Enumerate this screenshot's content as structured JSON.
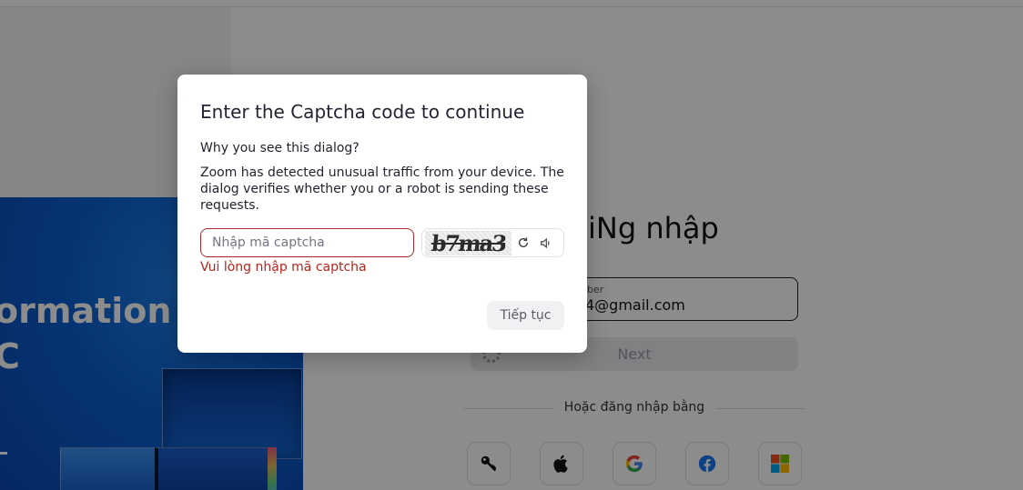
{
  "hero": {
    "text": "ormation\nC"
  },
  "login": {
    "title": "iNg nhập",
    "email_label": "ber",
    "email_value": "4@gmail.com",
    "next_label": "Next",
    "or_label": "Hoặc đăng nhập bằng",
    "social": [
      "key-icon",
      "apple-icon",
      "google-icon",
      "facebook-icon",
      "microsoft-icon"
    ]
  },
  "dialog": {
    "title": "Enter the Captcha code to continue",
    "question": "Why you see this dialog?",
    "description": "Zoom has detected unusual traffic from your device. The dialog verifies whether you or a robot is sending these requests.",
    "input_placeholder": "Nhập mã captcha",
    "input_value": "",
    "error": "Vui lòng nhập mã captcha",
    "captcha_text": "b7ma3",
    "continue_label": "Tiếp tục"
  },
  "colors": {
    "error": "#b3261e",
    "overlay": "rgba(0,0,0,0.45)",
    "hero_blue": "#0b5fd0"
  }
}
